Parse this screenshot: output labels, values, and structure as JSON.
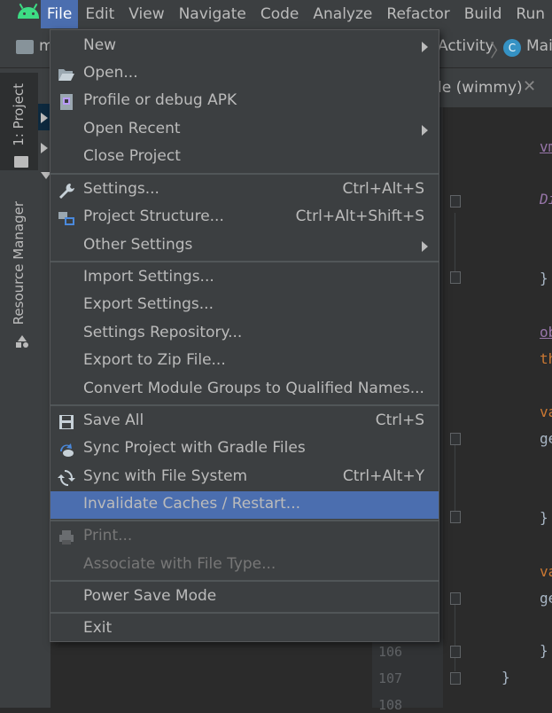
{
  "menubar": {
    "items": [
      "File",
      "Edit",
      "View",
      "Navigate",
      "Code",
      "Analyze",
      "Refactor",
      "Build",
      "Run"
    ]
  },
  "navbar": {
    "project": "m",
    "crumb": "Activity",
    "file": "Mai"
  },
  "tool_strip": {
    "project_tab": "1: Project",
    "resource_tab": "Resource Manager"
  },
  "editor": {
    "tab_label": "le (wimmy)",
    "line_numbers": [
      "106",
      "107",
      "108"
    ],
    "code": {
      "vm": "vm",
      "di": "Di",
      "brace1": "}",
      "ob": "ob",
      "th": "th",
      "va1": "va",
      "ge1": "ge",
      "brace2": "}",
      "va2": "va",
      "ge2": "ge",
      "brace3": "}",
      "brace4": "}"
    }
  },
  "file_menu": {
    "items": [
      {
        "label": "New",
        "submenu": true
      },
      {
        "label": "Open...",
        "icon": "folder-open-icon"
      },
      {
        "label": "Profile or debug APK",
        "icon": "apk-icon"
      },
      {
        "label": "Open Recent",
        "submenu": true
      },
      {
        "label": "Close Project"
      },
      {
        "label": "Settings...",
        "shortcut": "Ctrl+Alt+S",
        "icon": "wrench-icon"
      },
      {
        "label": "Project Structure...",
        "shortcut": "Ctrl+Alt+Shift+S",
        "icon": "project-structure-icon"
      },
      {
        "label": "Other Settings",
        "submenu": true
      },
      {
        "label": "Import Settings..."
      },
      {
        "label": "Export Settings..."
      },
      {
        "label": "Settings Repository..."
      },
      {
        "label": "Export to Zip File..."
      },
      {
        "label": "Convert Module Groups to Qualified Names..."
      },
      {
        "label": "Save All",
        "shortcut": "Ctrl+S",
        "icon": "save-icon"
      },
      {
        "label": "Sync Project with Gradle Files",
        "icon": "gradle-sync-icon"
      },
      {
        "label": "Sync with File System",
        "shortcut": "Ctrl+Alt+Y",
        "icon": "sync-icon"
      },
      {
        "label": "Invalidate Caches / Restart...",
        "highlighted": true
      },
      {
        "label": "Print...",
        "disabled": true,
        "icon": "print-icon"
      },
      {
        "label": "Associate with File Type...",
        "disabled": true
      },
      {
        "label": "Power Save Mode"
      },
      {
        "label": "Exit"
      }
    ]
  },
  "colors": {
    "background": "#2b2b2b",
    "panel": "#3c3f41",
    "highlight": "#4b6eaf",
    "text": "#bbbbbb",
    "disabled_text": "#777777",
    "android_green": "#3ddc84"
  }
}
